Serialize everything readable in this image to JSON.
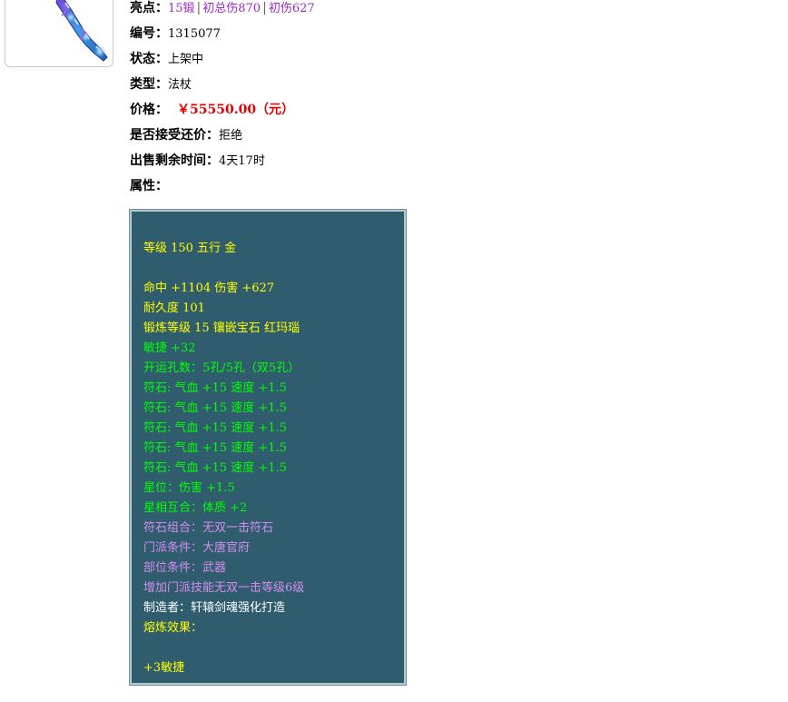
{
  "item_image": {
    "icon": "staff-icon"
  },
  "details": {
    "highlight_label": "亮点：",
    "highlight_items": [
      "15锻",
      "初总伤870",
      "初伤627"
    ],
    "highlight_sep": "|",
    "id_label": "编号：",
    "id_value": "1315077",
    "status_label": "状态：",
    "status_value": "上架中",
    "type_label": "类型：",
    "type_value": "法杖",
    "price_label": "价格：",
    "price_value": "￥55550.00（元）",
    "bargain_label": "是否接受还价：",
    "bargain_value": "拒绝",
    "time_left_label": "出售剩余时间：",
    "time_left_value": "4天17时",
    "attributes_label": "属性："
  },
  "attributes": {
    "level_line": "等级 150 五行 金",
    "hit_damage": "命中 +1104 伤害 +627",
    "durability": "耐久度 101",
    "forge": "锻炼等级 15 镶嵌宝石 红玛瑙",
    "agility": "敏捷 +32",
    "holes": "开运孔数：5孔/5孔（双5孔）",
    "runes": [
      "符石: 气血 +15 速度 +1.5",
      "符石: 气血 +15 速度 +1.5",
      "符石: 气血 +15 速度 +1.5",
      "符石: 气血 +15 速度 +1.5",
      "符石: 气血 +15 速度 +1.5"
    ],
    "star": "星位：伤害 +1.5",
    "star_sign": "星相互合：体质 +2",
    "rune_combo": "符石组合：无双一击符石",
    "sect_req": "门派条件：大唐官府",
    "slot_req": "部位条件：武器",
    "skill_bonus": "增加门派技能无双一击等级6级",
    "maker": "制造者：轩辕剑魂强化打造",
    "smelt_label": "熔炼效果：",
    "smelt_value": "+3敏捷"
  },
  "colors": {
    "panel_bg": "#2f5d6e",
    "yellow": "#ffff00",
    "green": "#00ff00",
    "purple": "#d58cf0",
    "price_red": "#e00000",
    "highlight_purple": "#9b28c8"
  }
}
